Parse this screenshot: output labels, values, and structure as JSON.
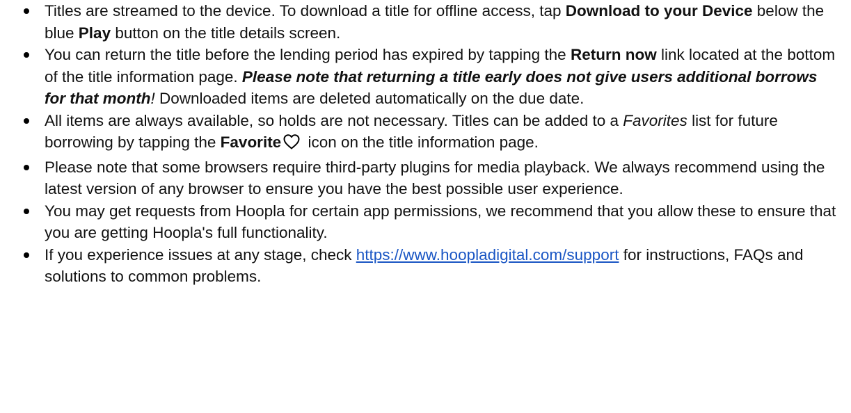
{
  "bullets": [
    {
      "p1": "Titles are streamed to the device. To download a title for offline access, tap ",
      "b1": "Download to your Device",
      "p2": " below the blue ",
      "b2": "Play",
      "p3": " button on the title details screen."
    },
    {
      "p1": "You can return the title before the lending period has expired by tapping the ",
      "b1": "Return now",
      "p2": " link located at the bottom of the title information page. ",
      "bi": "Please note that returning a title early does not give users additional borrows for that month",
      "i": "!",
      "p3": " Downloaded items are deleted automatically on the due date."
    },
    {
      "p1": "All items are always available, so holds are not necessary. Titles can be added to a ",
      "i": "Favorites",
      "p2": " list for future borrowing by tapping the ",
      "b1": "Favorite",
      "icon": "heart-outline-icon",
      "p3": " icon on the title information page."
    },
    {
      "p1": "Please note that some browsers require third-party plugins for media playback. We always recommend using the latest version of any browser to ensure you have the best possible user experience."
    },
    {
      "p1": "You may get requests from Hoopla for certain app permissions, we recommend that you allow these to ensure that you are getting Hoopla's full functionality."
    },
    {
      "p1": "If you experience issues at any stage, check ",
      "link": "https://www.hoopladigital.com/support",
      "p2": " for instructions, FAQs and solutions to common problems."
    }
  ],
  "colors": {
    "text": "#111111",
    "link": "#1a56c4"
  }
}
